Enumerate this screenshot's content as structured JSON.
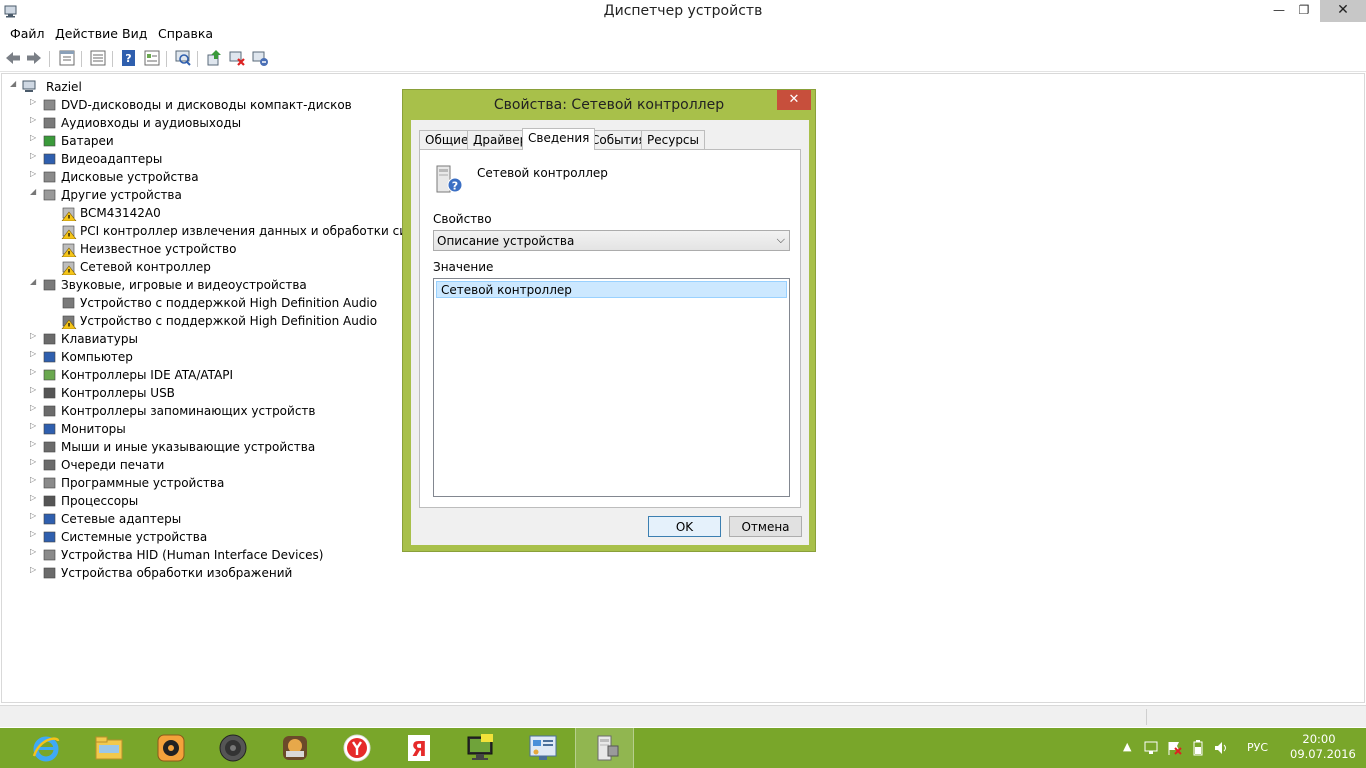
{
  "window": {
    "title": "Диспетчер устройств",
    "min_glyph": "—",
    "max_glyph": "❐",
    "close_glyph": "✕"
  },
  "menu": [
    "Файл",
    "Действие",
    "Вид",
    "Справка"
  ],
  "toolbar": [
    "back-icon",
    "forward-icon",
    "properties-icon",
    "show-hide-icon",
    "help-icon",
    "view-icon",
    "scan-icon",
    "update-driver-icon",
    "disable-device-icon",
    "uninstall-icon"
  ],
  "tree": {
    "root": "Raziel",
    "items": [
      {
        "label": "DVD-дисководы и дисководы компакт-дисков",
        "icon": "dvd-drive-icon",
        "level": 1,
        "expanded": false
      },
      {
        "label": "Аудиовходы и аудиовыходы",
        "icon": "speaker-icon",
        "level": 1,
        "expanded": false
      },
      {
        "label": "Батареи",
        "icon": "battery-icon",
        "level": 1,
        "expanded": false
      },
      {
        "label": "Видеоадаптеры",
        "icon": "display-adapter-icon",
        "level": 1,
        "expanded": false
      },
      {
        "label": "Дисковые устройства",
        "icon": "disk-drive-icon",
        "level": 1,
        "expanded": false
      },
      {
        "label": "Другие устройства",
        "icon": "other-devices-icon",
        "level": 1,
        "expanded": true
      },
      {
        "label": "BCM43142A0",
        "icon": "warning-device-icon",
        "level": 2
      },
      {
        "label": "PCI контроллер извлечения данных и обработки сигнала",
        "icon": "warning-device-icon",
        "level": 2
      },
      {
        "label": "Неизвестное устройство",
        "icon": "warning-device-icon",
        "level": 2
      },
      {
        "label": "Сетевой контроллер",
        "icon": "warning-device-icon",
        "level": 2
      },
      {
        "label": "Звуковые, игровые и видеоустройства",
        "icon": "speaker-icon",
        "level": 1,
        "expanded": true
      },
      {
        "label": "Устройство с поддержкой High Definition Audio",
        "icon": "speaker-icon",
        "level": 2
      },
      {
        "label": "Устройство с поддержкой High Definition Audio",
        "icon": "warning-speaker-icon",
        "level": 2
      },
      {
        "label": "Клавиатуры",
        "icon": "keyboard-icon",
        "level": 1,
        "expanded": false
      },
      {
        "label": "Компьютер",
        "icon": "computer-icon",
        "level": 1,
        "expanded": false
      },
      {
        "label": "Контроллеры IDE ATA/ATAPI",
        "icon": "ide-controller-icon",
        "level": 1,
        "expanded": false
      },
      {
        "label": "Контроллеры USB",
        "icon": "usb-icon",
        "level": 1,
        "expanded": false
      },
      {
        "label": "Контроллеры запоминающих устройств",
        "icon": "storage-controller-icon",
        "level": 1,
        "expanded": false
      },
      {
        "label": "Мониторы",
        "icon": "monitor-icon",
        "level": 1,
        "expanded": false
      },
      {
        "label": "Мыши и иные указывающие устройства",
        "icon": "mouse-icon",
        "level": 1,
        "expanded": false
      },
      {
        "label": "Очереди печати",
        "icon": "printer-icon",
        "level": 1,
        "expanded": false
      },
      {
        "label": "Программные устройства",
        "icon": "software-device-icon",
        "level": 1,
        "expanded": false
      },
      {
        "label": "Процессоры",
        "icon": "processor-icon",
        "level": 1,
        "expanded": false
      },
      {
        "label": "Сетевые адаптеры",
        "icon": "network-adapter-icon",
        "level": 1,
        "expanded": false
      },
      {
        "label": "Системные устройства",
        "icon": "system-device-icon",
        "level": 1,
        "expanded": false
      },
      {
        "label": "Устройства HID (Human Interface Devices)",
        "icon": "hid-icon",
        "level": 1,
        "expanded": false
      },
      {
        "label": "Устройства обработки изображений",
        "icon": "imaging-device-icon",
        "level": 1,
        "expanded": false
      }
    ]
  },
  "dialog": {
    "title": "Свойства: Сетевой контроллер",
    "close_glyph": "✕",
    "tabs": [
      "Общие",
      "Драйвер",
      "Сведения",
      "События",
      "Ресурсы"
    ],
    "active_tab": "Сведения",
    "device_name": "Сетевой контроллер",
    "property_label": "Свойство",
    "property_value": "Описание устройства",
    "value_label": "Значение",
    "values": [
      "Сетевой контроллер"
    ],
    "ok_label": "OK",
    "cancel_label": "Отмена"
  },
  "taskbar": {
    "apps": [
      "ie-icon",
      "explorer-icon",
      "media-player-icon",
      "speaker-app-icon",
      "doc-viewer-icon",
      "yandex-browser-icon",
      "yandex-icon",
      "monitor-app-icon",
      "control-panel-icon",
      "device-manager-icon"
    ],
    "active_index": 9,
    "tray_arrow": "▲",
    "lang": "РУС",
    "time": "20:00",
    "date": "09.07.2016"
  },
  "colors": {
    "dialog_frame": "#a8c04a",
    "taskbar": "#79a62a",
    "selection": "#cce8ff",
    "dialog_close": "#c74f3c"
  }
}
